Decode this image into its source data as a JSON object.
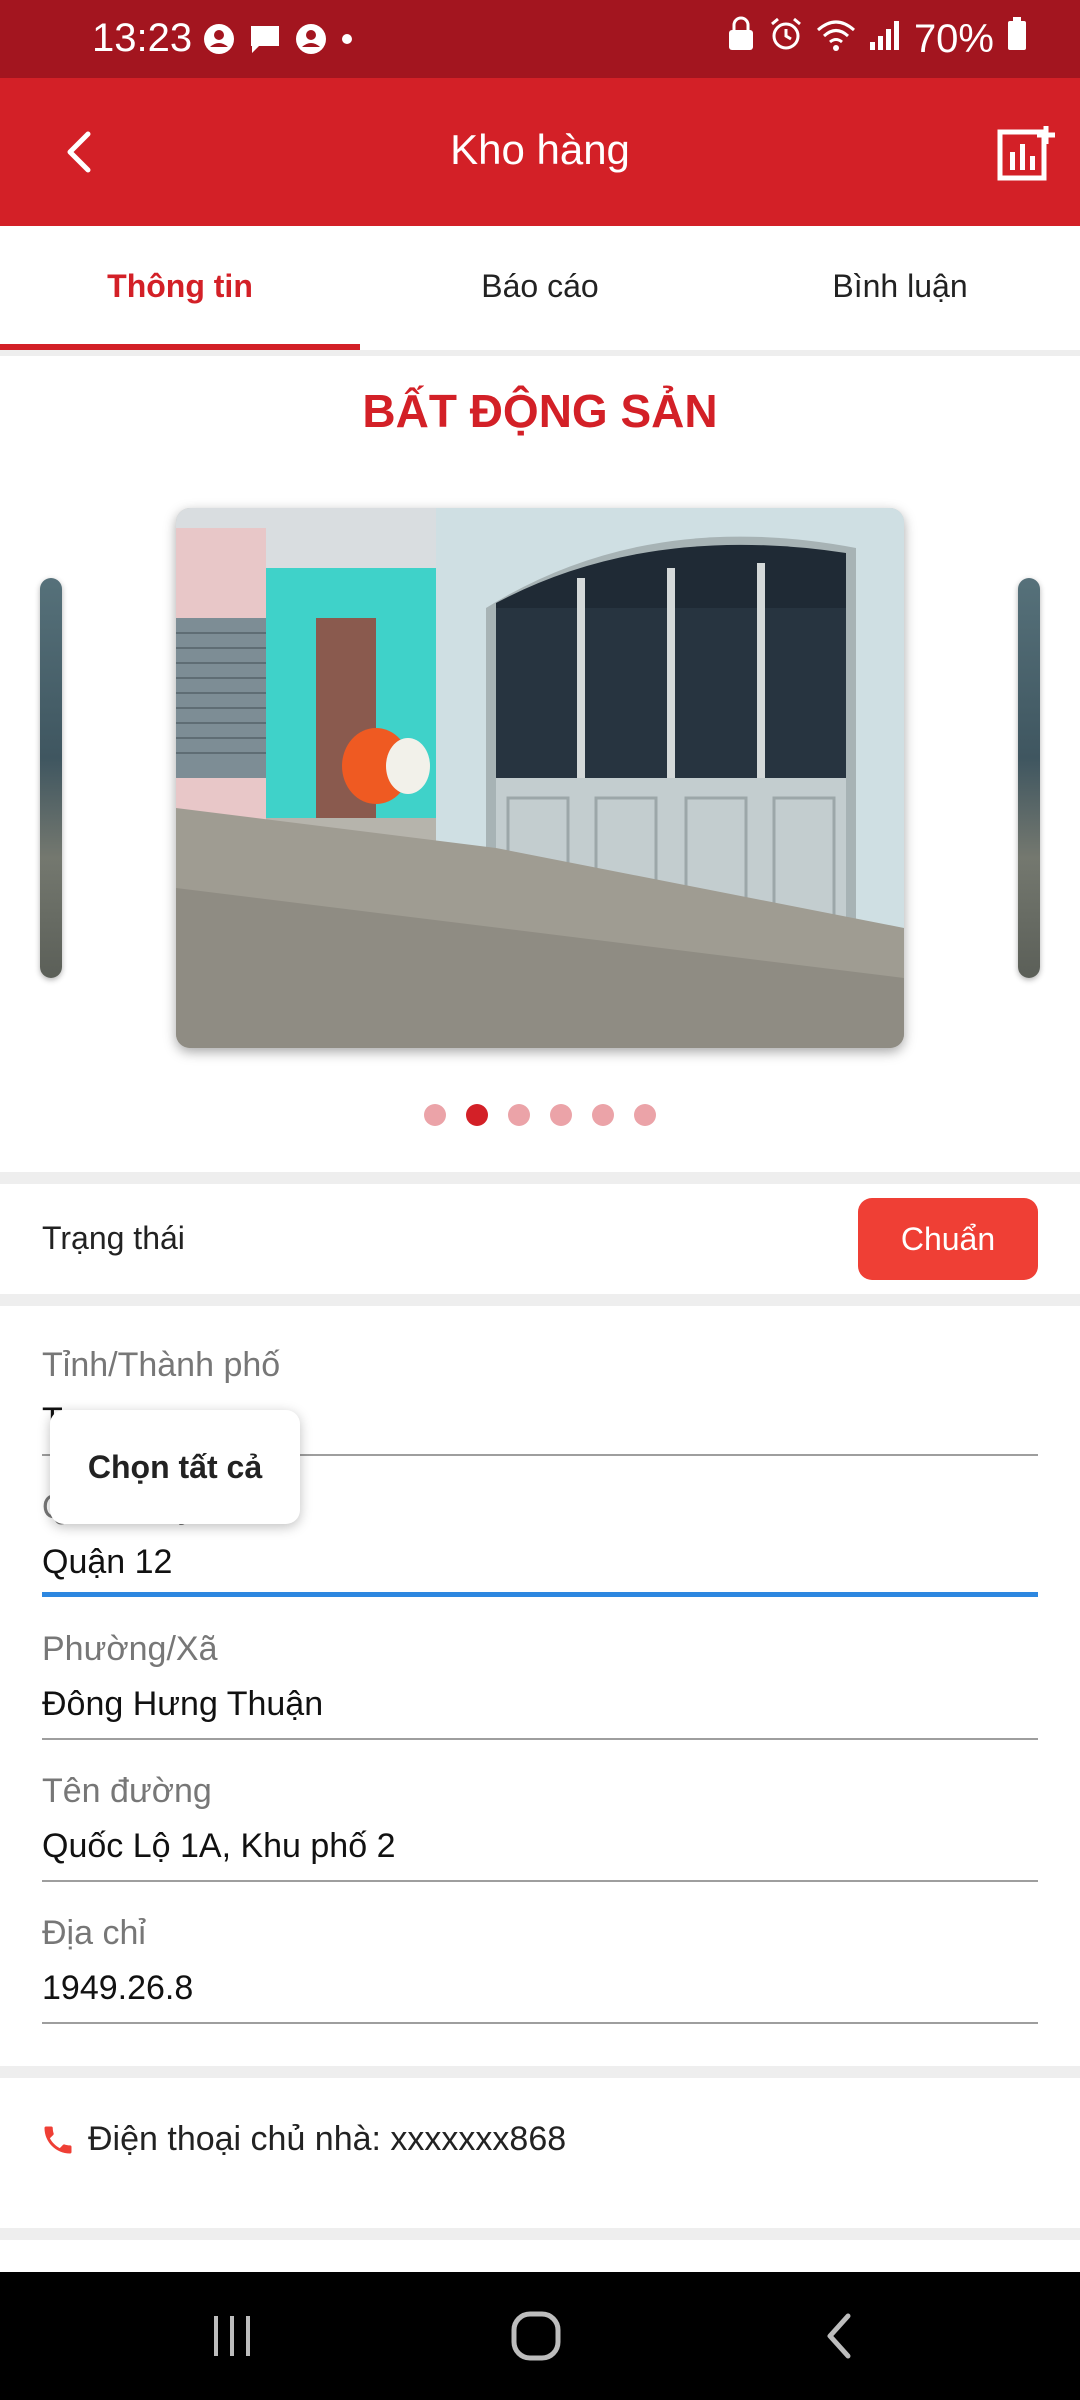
{
  "status_bar": {
    "time": "13:23",
    "battery": "70%",
    "notification_icons": [
      "contact-icon",
      "message-icon",
      "contact-icon",
      "dot-icon"
    ],
    "system_icons": [
      "lock-icon",
      "alarm-icon",
      "wifi-icon",
      "signal-icon",
      "battery-icon"
    ]
  },
  "app_bar": {
    "title": "Kho hàng",
    "back_icon": "chevron-left-icon",
    "action_icon": "add-report-icon"
  },
  "tabs": [
    {
      "label": "Thông tin",
      "active": true
    },
    {
      "label": "Báo cáo",
      "active": false
    },
    {
      "label": "Bình luận",
      "active": false
    }
  ],
  "section": {
    "title": "BẤT ĐỘNG SẢN"
  },
  "carousel": {
    "total_images": 6,
    "active_index": 1
  },
  "status": {
    "label": "Trạng thái",
    "value": "Chuẩn"
  },
  "fields": {
    "province": {
      "label": "Tỉnh/Thành phố",
      "value": "T..."
    },
    "district": {
      "label": "Quận/Huyện",
      "value": "Quận 12"
    },
    "ward": {
      "label": "Phường/Xã",
      "value": "Đông Hưng Thuận"
    },
    "street": {
      "label": "Tên đường",
      "value": "Quốc Lộ 1A, Khu phố 2"
    },
    "address": {
      "label": "Địa chỉ",
      "value": "1949.26.8"
    }
  },
  "context_menu": {
    "select_all": "Chọn tất cả"
  },
  "owner_phone": {
    "text": "Điện thoại chủ nhà: xxxxxxx868",
    "icon": "phone-icon"
  },
  "nav_bar": {
    "icons": [
      "recent-apps-icon",
      "home-icon",
      "back-icon"
    ]
  },
  "colors": {
    "status_bar": "#a3151f",
    "primary": "#d32027",
    "badge": "#ef3f35",
    "focus_underline": "#2d87e0"
  }
}
